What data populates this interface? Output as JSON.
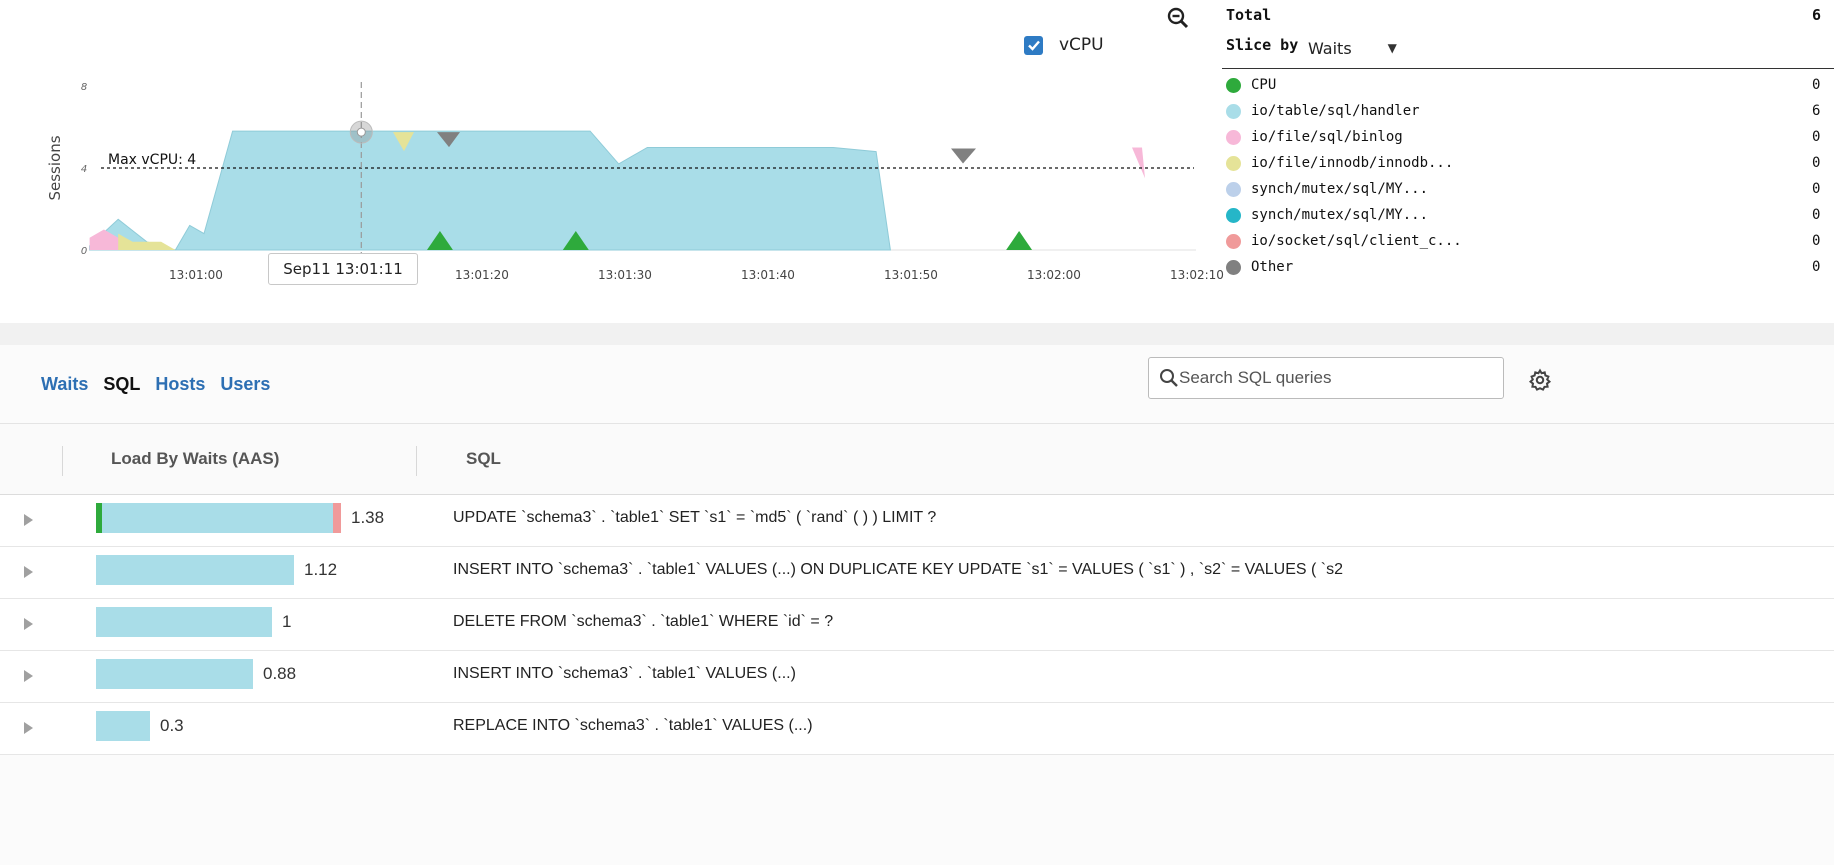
{
  "chart": {
    "y_axis_title": "Sessions",
    "y_ticks": [
      "0",
      "4",
      "8"
    ],
    "x_ticks": [
      "13:01:00",
      "13:01:20",
      "13:01:30",
      "13:01:40",
      "13:01:50",
      "13:02:00",
      "13:02:10"
    ],
    "max_vcpu_label": "Max vCPU: 4",
    "max_vcpu": 4,
    "hover_time": "Sep11 13:01:11",
    "vcpu_label": "vCPU",
    "vcpu_checked": true
  },
  "chart_data": {
    "type": "area",
    "x_ticks": [
      "13:01:00",
      "13:01:20",
      "13:01:30",
      "13:01:40",
      "13:01:50",
      "13:02:00",
      "13:02:10"
    ],
    "ylabel": "Sessions",
    "ylim": [
      0,
      8
    ],
    "series": [
      {
        "name": "io/table/sql/handler",
        "color": "#a9dde8",
        "points": [
          [
            52,
            0.2
          ],
          [
            54,
            1.5
          ],
          [
            56,
            0.4
          ],
          [
            58,
            0
          ],
          [
            59,
            1.2
          ],
          [
            60,
            0.8
          ],
          [
            62,
            5.8
          ],
          [
            67,
            5.8
          ],
          [
            80,
            5.8
          ],
          [
            87,
            5.8
          ],
          [
            89,
            4.2
          ],
          [
            91,
            5.0
          ],
          [
            104,
            5.0
          ],
          [
            107,
            4.8
          ],
          [
            108,
            0
          ]
        ]
      },
      {
        "name": "io/file/sql/binlog",
        "color": "#f7b8d8",
        "points": [
          [
            52,
            0.6
          ],
          [
            53,
            1.0
          ],
          [
            54,
            0.6
          ],
          [
            56,
            0
          ]
        ]
      },
      {
        "name": "io/file/innodb/innodb...",
        "color": "#e5e398",
        "points": [
          [
            54,
            0.8
          ],
          [
            55,
            0.4
          ],
          [
            57,
            0.4
          ],
          [
            58,
            0
          ]
        ]
      }
    ],
    "max_vcpu": 4,
    "legend_position": "right"
  },
  "legend": {
    "total_label": "Total",
    "total_value": "6",
    "slice_label": "Slice by",
    "slice_value": "Waits",
    "items": [
      {
        "name": "CPU",
        "value": "0",
        "color": "#2eaa3c"
      },
      {
        "name": "io/table/sql/handler",
        "value": "6",
        "color": "#a9dde8"
      },
      {
        "name": "io/file/sql/binlog",
        "value": "0",
        "color": "#f7b8d8"
      },
      {
        "name": "io/file/innodb/innodb...",
        "value": "0",
        "color": "#e5e398"
      },
      {
        "name": "synch/mutex/sql/MY...",
        "value": "0",
        "color": "#bcd0ea"
      },
      {
        "name": "synch/mutex/sql/MY...",
        "value": "0",
        "color": "#25b6c8"
      },
      {
        "name": "io/socket/sql/client_c...",
        "value": "0",
        "color": "#f09a9a"
      },
      {
        "name": "Other",
        "value": "0",
        "color": "#808080"
      }
    ]
  },
  "tabs": [
    {
      "label": "Waits",
      "active": false
    },
    {
      "label": "SQL",
      "active": true
    },
    {
      "label": "Hosts",
      "active": false
    },
    {
      "label": "Users",
      "active": false
    }
  ],
  "search": {
    "placeholder": "Search SQL queries"
  },
  "table": {
    "headers": {
      "load": "Load By Waits (AAS)",
      "sql": "SQL"
    },
    "rows": [
      {
        "load": "1.38",
        "load_fraction": 1.0,
        "sql": "UPDATE `schema3` . `table1` SET `s1` = `md5` ( `rand` ( ) ) LIMIT ?"
      },
      {
        "load": "1.12",
        "load_fraction": 0.81,
        "sql": "INSERT INTO `schema3` . `table1` VALUES (...) ON DUPLICATE KEY UPDATE `s1` = VALUES ( `s1` ) , `s2` = VALUES ( `s2"
      },
      {
        "load": "1",
        "load_fraction": 0.72,
        "sql": "DELETE FROM `schema3` . `table1` WHERE `id` = ?"
      },
      {
        "load": "0.88",
        "load_fraction": 0.64,
        "sql": "INSERT INTO `schema3` . `table1` VALUES (...)"
      },
      {
        "load": "0.3",
        "load_fraction": 0.22,
        "sql": "REPLACE INTO `schema3` . `table1` VALUES (...)"
      }
    ]
  }
}
